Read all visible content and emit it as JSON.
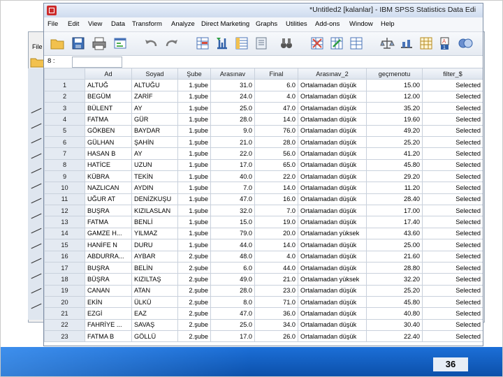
{
  "window": {
    "title": "*Untitled2 [kalanlar] - IBM SPSS Statistics Data Edi",
    "menus": [
      "File",
      "Edit",
      "View",
      "Data",
      "Transform",
      "Analyze",
      "Direct Marketing",
      "Graphs",
      "Utilities",
      "Add-ons",
      "Window",
      "Help"
    ],
    "cell_reference": "8 :"
  },
  "background_window": {
    "menu_label": "File"
  },
  "toolbar_icons": [
    "open-folder-icon",
    "save-icon",
    "print-icon",
    "recall-dialog-icon",
    "undo-icon",
    "redo-icon",
    "goto-case-icon",
    "goto-variable-icon",
    "variables-icon",
    "find-icon",
    "insert-cases-icon",
    "insert-variable-icon",
    "split-file-icon",
    "weight-cases-icon",
    "select-cases-icon",
    "value-labels-icon",
    "use-sets-icon",
    "show-all-variables-icon"
  ],
  "grid": {
    "columns": [
      "Ad",
      "Soyad",
      "Şube",
      "Arasınav",
      "Final",
      "Arasınav_2",
      "geçmenotu",
      "filter_$"
    ],
    "rows": [
      [
        "1",
        "ALTUĞ",
        "ALTUĞU",
        "1.şube",
        "31.0",
        "6.0",
        "Ortalamadan düşük",
        "15.00",
        "Selected"
      ],
      [
        "2",
        "BEGÜM",
        "ZARİF",
        "1.şube",
        "24.0",
        "4.0",
        "Ortalamadan düşük",
        "12.00",
        "Selected"
      ],
      [
        "3",
        "BÜLENT",
        "AY",
        "1.şube",
        "25.0",
        "47.0",
        "Ortalamadan düşük",
        "35.20",
        "Selected"
      ],
      [
        "4",
        "FATMA",
        "GÜR",
        "1.şube",
        "28.0",
        "14.0",
        "Ortalamadan düşük",
        "19.60",
        "Selected"
      ],
      [
        "5",
        "GÖKBEN",
        "BAYDAR",
        "1.şube",
        "9.0",
        "76.0",
        "Ortalamadan düşük",
        "49.20",
        "Selected"
      ],
      [
        "6",
        "GÜLHAN",
        "ŞAHİN",
        "1.şube",
        "21.0",
        "28.0",
        "Ortalamadan düşük",
        "25.20",
        "Selected"
      ],
      [
        "7",
        "HASAN B",
        "AY",
        "1.şube",
        "22.0",
        "56.0",
        "Ortalamadan düşük",
        "41.20",
        "Selected"
      ],
      [
        "8",
        "HATİCE",
        "UZUN",
        "1.şube",
        "17.0",
        "65.0",
        "Ortalamadan düşük",
        "45.80",
        "Selected"
      ],
      [
        "9",
        "KÜBRA",
        "TEKİN",
        "1.şube",
        "40.0",
        "22.0",
        "Ortalamadan düşük",
        "29.20",
        "Selected"
      ],
      [
        "10",
        "NAZLICAN",
        "AYDIN",
        "1.şube",
        "7.0",
        "14.0",
        "Ortalamadan düşük",
        "11.20",
        "Selected"
      ],
      [
        "11",
        "UĞUR AT",
        "DENİZKUŞU",
        "1.şube",
        "47.0",
        "16.0",
        "Ortalamadan düşük",
        "28.40",
        "Selected"
      ],
      [
        "12",
        "BUŞRA",
        "KIZILASLAN",
        "1.şube",
        "32.0",
        "7.0",
        "Ortalamadan düşük",
        "17.00",
        "Selected"
      ],
      [
        "13",
        "FATMA",
        "BENLİ",
        "1.şube",
        "15.0",
        "19.0",
        "Ortalamadan düşük",
        "17.40",
        "Selected"
      ],
      [
        "14",
        "GAMZE H...",
        "YILMAZ",
        "1.şube",
        "79.0",
        "20.0",
        "Ortalamadan yüksek",
        "43.60",
        "Selected"
      ],
      [
        "15",
        "HANİFE N",
        "DURU",
        "1.şube",
        "44.0",
        "14.0",
        "Ortalamadan düşük",
        "25.00",
        "Selected"
      ],
      [
        "16",
        "ABDURRA...",
        "AYBAR",
        "2.şube",
        "48.0",
        "4.0",
        "Ortalamadan düşük",
        "21.60",
        "Selected"
      ],
      [
        "17",
        "BUŞRA",
        "BELİN",
        "2.şube",
        "6.0",
        "44.0",
        "Ortalamadan düşük",
        "28.80",
        "Selected"
      ],
      [
        "18",
        "BÜŞRA",
        "KIZILTAŞ",
        "2.şube",
        "49.0",
        "21.0",
        "Ortalamadan yüksek",
        "32.20",
        "Selected"
      ],
      [
        "19",
        "CANAN",
        "ATAN",
        "2.şube",
        "28.0",
        "23.0",
        "Ortalamadan düşük",
        "25.20",
        "Selected"
      ],
      [
        "20",
        "EKİN",
        "ÜLKÜ",
        "2.şube",
        "8.0",
        "71.0",
        "Ortalamadan düşük",
        "45.80",
        "Selected"
      ],
      [
        "21",
        "EZGİ",
        "EAZ",
        "2.şube",
        "47.0",
        "36.0",
        "Ortalamadan düşük",
        "40.80",
        "Selected"
      ],
      [
        "22",
        "FAHRİYE ...",
        "SAVAŞ",
        "2.şube",
        "25.0",
        "34.0",
        "Ortalamadan düşük",
        "30.40",
        "Selected"
      ],
      [
        "23",
        "FATMA B",
        "GÖLLÜ",
        "2.şube",
        "17.0",
        "26.0",
        "Ortalamadan düşük",
        "22.40",
        "Selected"
      ]
    ]
  },
  "slide": {
    "page_number": "36"
  },
  "colors": {
    "footer_blue": "#1465c8",
    "title_bar": "#d6e2f2",
    "grid_header": "#e4eaf2"
  }
}
